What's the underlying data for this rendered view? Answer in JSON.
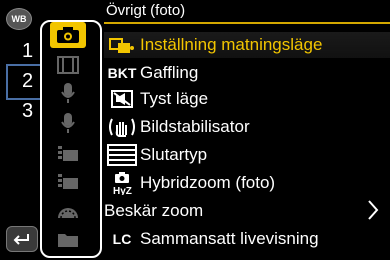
{
  "badge": {
    "label": "WB"
  },
  "pages": [
    "1",
    "2",
    "3"
  ],
  "menu": {
    "title": "Övrigt (foto)",
    "items": [
      {
        "icon": "drive-mode-icon",
        "icon_text": "",
        "label": "Inställning matningsläge"
      },
      {
        "icon": "bkt-icon",
        "icon_text": "BKT",
        "label": "Gaffling"
      },
      {
        "icon": "silent-mode-icon",
        "icon_text": "",
        "label": "Tyst läge"
      },
      {
        "icon": "stabilizer-icon",
        "icon_text": "",
        "label": "Bildstabilisator"
      },
      {
        "icon": "shutter-type-icon",
        "icon_text": "",
        "label": "Slutartyp"
      },
      {
        "icon": "hybrid-zoom-icon",
        "icon_text": "",
        "label": "Hybridzoom (foto)"
      },
      {
        "icon": "",
        "icon_text": "",
        "label": "Beskär zoom"
      },
      {
        "icon": "lc-icon",
        "icon_text": "LC",
        "label": "Sammansatt livevisning"
      }
    ]
  },
  "tabs": [
    "camera-icon",
    "film-icon",
    "mic-icon",
    "mic-icon",
    "video-setting-icon",
    "video-setting-icon",
    "dial-icon",
    "folder-icon"
  ],
  "colors": {
    "accent": "#f2c500",
    "page_bar": "#4a6fa5"
  }
}
